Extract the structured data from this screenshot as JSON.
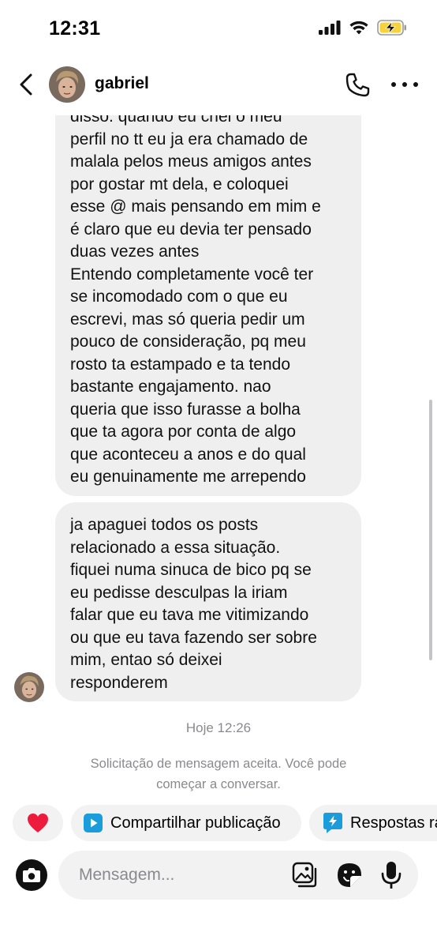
{
  "status_bar": {
    "time": "12:31",
    "icons": [
      "signal-icon",
      "wifi-icon",
      "battery-charging-icon"
    ],
    "battery_color": "#f7d23a"
  },
  "header": {
    "contact_name": "gabriel",
    "icons": [
      "back-chevron-icon",
      "phone-icon",
      "more-icon"
    ]
  },
  "messages": [
    {
      "sender": "gabriel",
      "lines": [
        "disso. quando eu criei o meu",
        "perfil no tt eu ja era chamado de",
        "malala pelos meus amigos antes",
        "por gostar mt dela, e coloquei",
        "esse @ mais pensando em mim e",
        "é claro que eu devia ter pensado",
        "duas vezes antes",
        "Entendo completamente você ter",
        "se incomodado com o que eu",
        "escrevi, mas só queria pedir um",
        "pouco de consideração, pq meu",
        "rosto ta estampado e ta tendo",
        "bastante engajamento. nao",
        "queria que isso furasse a bolha",
        "que ta agora por conta de algo",
        "que aconteceu a anos e do qual",
        "eu genuinamente me arrependo"
      ]
    },
    {
      "sender": "gabriel",
      "lines": [
        "ja apaguei todos os posts",
        "relacionado a essa situação.",
        "fiquei numa sinuca de bico pq se",
        "eu pedisse desculpas la iriam",
        "falar que eu tava me vitimizando",
        "ou que eu tava fazendo ser sobre",
        "mim, entao só deixei",
        "responderem"
      ]
    }
  ],
  "timestamp": "Hoje 12:26",
  "notice": {
    "line1": "Solicitação de mensagem aceita. Você pode",
    "line2": "começar a conversar."
  },
  "quick_actions": {
    "heart_icon": "heart-icon",
    "heart_color": "#ed1c3d",
    "share_label": "Compartilhar publicação",
    "share_icon_color": "#1b9ddb",
    "replies_label": "Respostas rá"
  },
  "composer": {
    "placeholder": "Mensagem...",
    "icons": [
      "camera-icon",
      "gallery-icon",
      "sticker-icon",
      "microphone-icon"
    ]
  }
}
